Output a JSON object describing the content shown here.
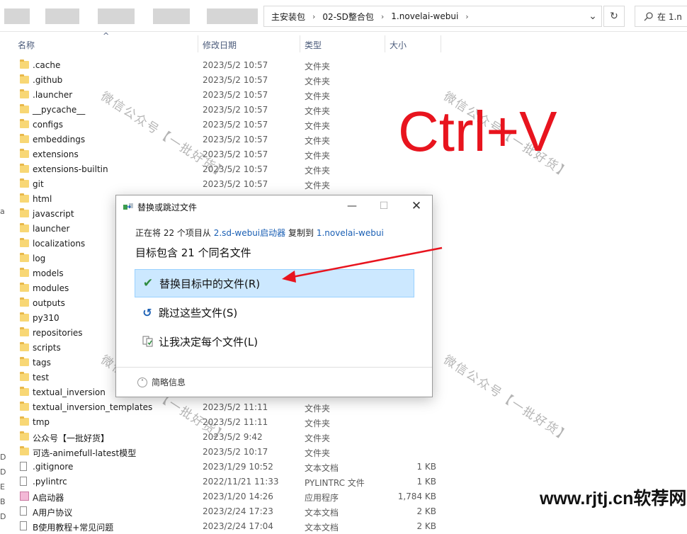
{
  "breadcrumb": [
    "主安装包",
    "02-SD整合包",
    "1.novelai-webui"
  ],
  "search": {
    "text": "在 1.n"
  },
  "columns": {
    "name": "名称",
    "modified": "修改日期",
    "type": "类型",
    "size": "大小"
  },
  "left_strip": [
    "a",
    "D",
    "D",
    "E",
    "B",
    "D"
  ],
  "files": [
    {
      "name": ".cache",
      "modified": "2023/5/2 10:57",
      "type": "文件夹",
      "size": "",
      "icon": "folder-icon"
    },
    {
      "name": ".github",
      "modified": "2023/5/2 10:57",
      "type": "文件夹",
      "size": "",
      "icon": "folder-icon"
    },
    {
      "name": ".launcher",
      "modified": "2023/5/2 10:57",
      "type": "文件夹",
      "size": "",
      "icon": "folder-icon"
    },
    {
      "name": "__pycache__",
      "modified": "2023/5/2 10:57",
      "type": "文件夹",
      "size": "",
      "icon": "folder-icon"
    },
    {
      "name": "configs",
      "modified": "2023/5/2 10:57",
      "type": "文件夹",
      "size": "",
      "icon": "folder-icon"
    },
    {
      "name": "embeddings",
      "modified": "2023/5/2 10:57",
      "type": "文件夹",
      "size": "",
      "icon": "folder-icon"
    },
    {
      "name": "extensions",
      "modified": "2023/5/2 10:57",
      "type": "文件夹",
      "size": "",
      "icon": "folder-icon"
    },
    {
      "name": "extensions-builtin",
      "modified": "2023/5/2 10:57",
      "type": "文件夹",
      "size": "",
      "icon": "folder-icon"
    },
    {
      "name": "git",
      "modified": "2023/5/2 10:57",
      "type": "文件夹",
      "size": "",
      "icon": "folder-icon"
    },
    {
      "name": "html",
      "modified": "",
      "type": "",
      "size": "",
      "icon": "folder-icon"
    },
    {
      "name": "javascript",
      "modified": "",
      "type": "",
      "size": "",
      "icon": "folder-icon"
    },
    {
      "name": "launcher",
      "modified": "",
      "type": "",
      "size": "",
      "icon": "folder-icon"
    },
    {
      "name": "localizations",
      "modified": "",
      "type": "",
      "size": "",
      "icon": "folder-icon"
    },
    {
      "name": "log",
      "modified": "",
      "type": "",
      "size": "",
      "icon": "folder-icon"
    },
    {
      "name": "models",
      "modified": "",
      "type": "",
      "size": "",
      "icon": "folder-icon"
    },
    {
      "name": "modules",
      "modified": "",
      "type": "",
      "size": "",
      "icon": "folder-icon"
    },
    {
      "name": "outputs",
      "modified": "",
      "type": "",
      "size": "",
      "icon": "folder-icon"
    },
    {
      "name": "py310",
      "modified": "",
      "type": "",
      "size": "",
      "icon": "folder-icon"
    },
    {
      "name": "repositories",
      "modified": "",
      "type": "",
      "size": "",
      "icon": "folder-icon"
    },
    {
      "name": "scripts",
      "modified": "",
      "type": "",
      "size": "",
      "icon": "folder-icon"
    },
    {
      "name": "tags",
      "modified": "",
      "type": "",
      "size": "",
      "icon": "folder-icon"
    },
    {
      "name": "test",
      "modified": "",
      "type": "",
      "size": "",
      "icon": "folder-icon"
    },
    {
      "name": "textual_inversion",
      "modified": "",
      "type": "",
      "size": "",
      "icon": "folder-icon"
    },
    {
      "name": "textual_inversion_templates",
      "modified": "2023/5/2 11:11",
      "type": "文件夹",
      "size": "",
      "icon": "folder-icon"
    },
    {
      "name": "tmp",
      "modified": "2023/5/2 11:11",
      "type": "文件夹",
      "size": "",
      "icon": "folder-icon"
    },
    {
      "name": "公众号【一批好货】",
      "modified": "2023/5/2 9:42",
      "type": "文件夹",
      "size": "",
      "icon": "folder-icon"
    },
    {
      "name": "可选-animefull-latest模型",
      "modified": "2023/5/2 10:17",
      "type": "文件夹",
      "size": "",
      "icon": "folder-icon"
    },
    {
      "name": ".gitignore",
      "modified": "2023/1/29 10:52",
      "type": "文本文档",
      "size": "1 KB",
      "icon": "text-file-icon"
    },
    {
      "name": ".pylintrc",
      "modified": "2022/11/21 11:33",
      "type": "PYLINTRC 文件",
      "size": "1 KB",
      "icon": "file-icon"
    },
    {
      "name": "A启动器",
      "modified": "2023/1/20 14:26",
      "type": "应用程序",
      "size": "1,784 KB",
      "icon": "app-icon"
    },
    {
      "name": "A用户协议",
      "modified": "2023/2/24 17:23",
      "type": "文本文档",
      "size": "2 KB",
      "icon": "text-file-icon"
    },
    {
      "name": "B使用教程+常见问题",
      "modified": "2023/2/24 17:04",
      "type": "文本文档",
      "size": "2 KB",
      "icon": "text-file-icon"
    }
  ],
  "dialog": {
    "title": "替换或跳过文件",
    "copy_prefix": "正在将 22 个项目从",
    "source": "2.sd-webui启动器",
    "copy_mid": "复制到",
    "dest": "1.novelai-webui",
    "heading": "目标包含 21 个同名文件",
    "replace_label": "替换目标中的文件(R)",
    "skip_label": "跳过这些文件(S)",
    "decide_label": "让我决定每个文件(L)",
    "details_label": "简略信息"
  },
  "overlay": {
    "hotkey": "Ctrl+V",
    "watermark": "微信公众号【一批好货】",
    "site": "www.rjtj.cn软荐网",
    "annotation_color": "#e8141e"
  }
}
